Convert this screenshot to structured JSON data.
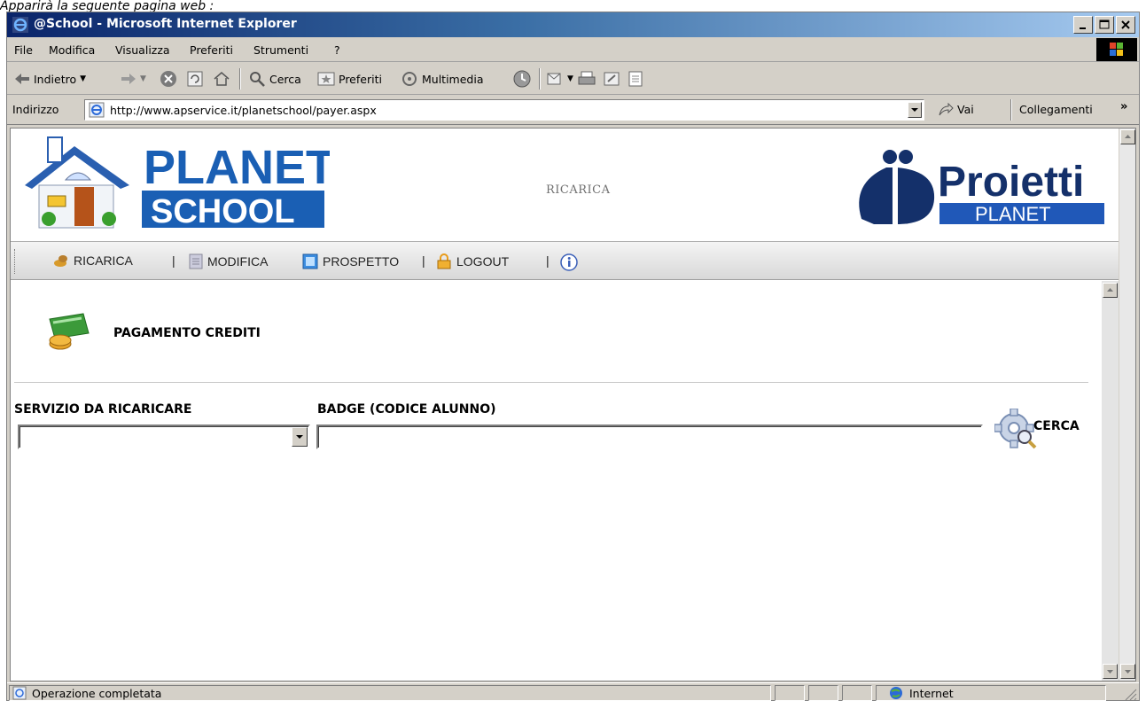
{
  "caption": "Apparirà la seguente pagina web :",
  "window": {
    "title": "@School - Microsoft Internet Explorer"
  },
  "menu": [
    "File",
    "Modifica",
    "Visualizza",
    "Preferiti",
    "Strumenti",
    "?"
  ],
  "toolbar": {
    "back": "Indietro",
    "search": "Cerca",
    "favorites": "Preferiti",
    "media": "Multimedia"
  },
  "address": {
    "label": "Indirizzo",
    "url": "http://www.apservice.it/planetschool/payer.aspx",
    "go": "Vai",
    "links": "Collegamenti"
  },
  "banner": {
    "logo_left_line1": "PLANET",
    "logo_left_line2": "SCHOOL",
    "heading": "RICARICA",
    "logo_right_line1": "Proietti",
    "logo_right_line2": "PLANET"
  },
  "nav": {
    "recharge": "RICARICA",
    "edit": "MODIFICA",
    "report": "PROSPETTO",
    "logout": "LOGOUT",
    "separator": "|"
  },
  "content": {
    "section_title": "PAGAMENTO CREDITI",
    "service_label": "SERVIZIO DA RICARICARE",
    "service_value": "",
    "badge_label": "BADGE (CODICE ALUNNO)",
    "badge_value": "",
    "search_button": "CERCA"
  },
  "status": {
    "text": "Operazione completata",
    "zone": "Internet"
  },
  "colors": {
    "title_gradient_start": "#0a246a",
    "title_gradient_end": "#a6caf0",
    "planet_blue": "#1a5fb4",
    "proietti_navy": "#14306a"
  }
}
